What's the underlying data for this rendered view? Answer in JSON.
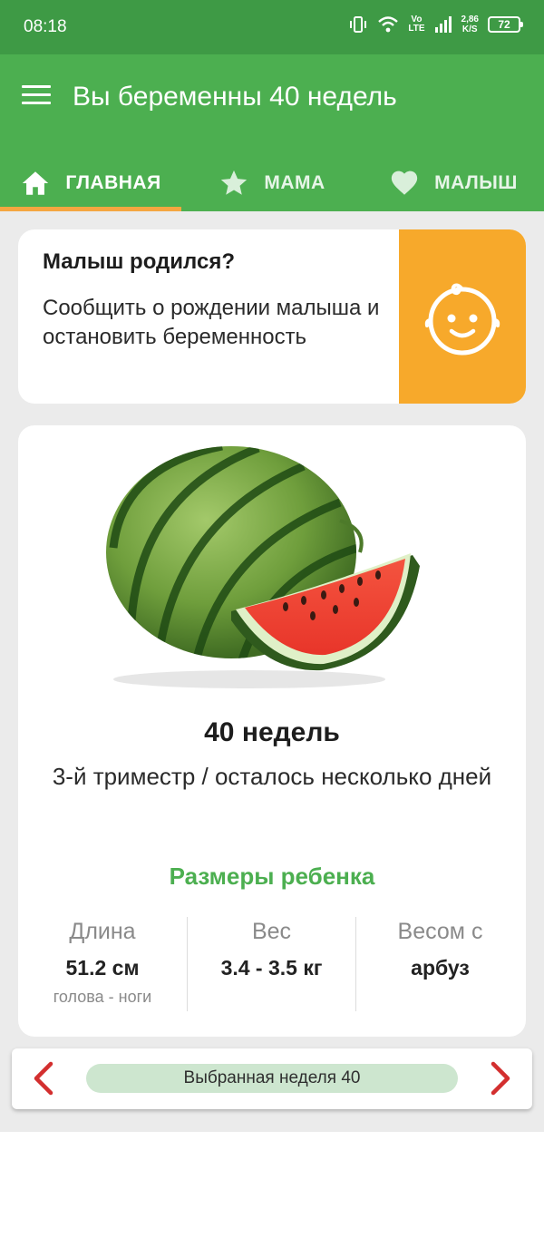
{
  "status_bar": {
    "time": "08:18",
    "network_vo": "Vo",
    "network_lte": "LTE",
    "speed_value": "2,86",
    "speed_unit": "K/S",
    "battery": "72"
  },
  "app_bar": {
    "title": "Вы беременны 40 недель",
    "menu_icon": "hamburger-menu-icon"
  },
  "tabs": [
    {
      "label": "ГЛАВНАЯ",
      "icon": "home-icon",
      "active": true
    },
    {
      "label": "МАМА",
      "icon": "star-icon",
      "active": false
    },
    {
      "label": "МАЛЫШ",
      "icon": "heart-icon",
      "active": false
    }
  ],
  "born_card": {
    "title": "Малыш родился?",
    "text": "Сообщить о рождении малыша и остановить беременность",
    "icon": "baby-face-icon"
  },
  "week_card": {
    "image": "watermelon-image",
    "title": "40 недель",
    "subtitle": "3-й триместр / осталось несколько дней",
    "sizes_title": "Размеры ребенка",
    "stats": [
      {
        "label": "Длина",
        "value": "51.2 см",
        "note": "голова - ноги"
      },
      {
        "label": "Вес",
        "value": "3.4 - 3.5 кг",
        "note": ""
      },
      {
        "label": "Весом с",
        "value": "арбуз",
        "note": ""
      }
    ]
  },
  "week_nav": {
    "selected_label": "Выбранная неделя 40",
    "prev_icon": "chevron-left-icon",
    "next_icon": "chevron-right-icon"
  },
  "colors": {
    "status_bar": "#3e9a45",
    "app_bar": "#4caf50",
    "tab_indicator": "#f4a640",
    "accent_orange": "#f7a92b",
    "accent_green": "#4caf50",
    "arrow_red": "#d32f2f",
    "pill_bg": "#cde6cf"
  }
}
